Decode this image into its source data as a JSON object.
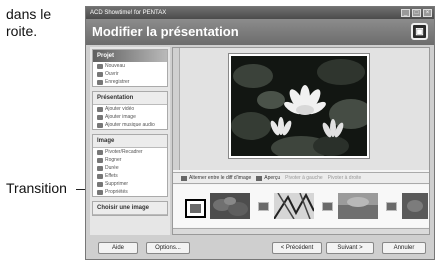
{
  "caption": {
    "line1": "dans le",
    "line2": "roite."
  },
  "transition_label": "Transition",
  "window": {
    "title": "ACD Showtime! for PENTAX",
    "header_title": "Modifier la présentation",
    "header_icon": "photo-frame-icon"
  },
  "sidebar": {
    "panels": [
      {
        "title": "Projet",
        "items": [
          {
            "label": "Nouveau",
            "icon": "new-icon"
          },
          {
            "label": "Ouvrir",
            "icon": "open-icon"
          },
          {
            "label": "Enregistrer",
            "icon": "save-icon"
          }
        ]
      },
      {
        "title": "Présentation",
        "items": [
          {
            "label": "Ajouter vidéo",
            "icon": "add-video-icon"
          },
          {
            "label": "Ajouter image",
            "icon": "add-image-icon"
          },
          {
            "label": "Ajouter musique audio",
            "icon": "add-music-icon"
          }
        ]
      },
      {
        "title": "Image",
        "items": [
          {
            "label": "Pivoter/Recadrer",
            "icon": "rotate-icon"
          },
          {
            "label": "Rogner",
            "icon": "crop-icon"
          },
          {
            "label": "Durée",
            "icon": "duration-icon"
          },
          {
            "label": "Effets",
            "icon": "effects-icon"
          },
          {
            "label": "Supprimer",
            "icon": "delete-icon"
          },
          {
            "label": "Propriétés",
            "icon": "properties-icon"
          }
        ]
      },
      {
        "title": "Choisir une image",
        "items": []
      }
    ]
  },
  "toolbar": {
    "alternate": "Alterner entre le diff d'image",
    "preview": "Aperçu",
    "rotate_left": "Pivoter à gauche",
    "rotate_right": "Pivoter à droite"
  },
  "footer": {
    "help": "Aide",
    "options": "Options...",
    "previous": "< Précédent",
    "next": "Suivant >",
    "cancel": "Annuler"
  },
  "colors": {
    "header": "#7a7a7a",
    "titlebar": "#5a5a5a",
    "frame": "#cfcfcf"
  }
}
